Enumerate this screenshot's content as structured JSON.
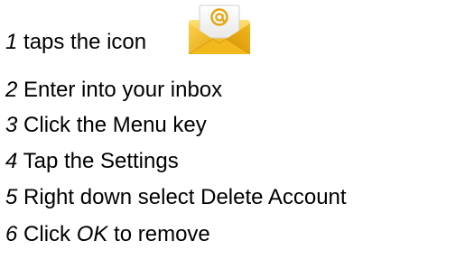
{
  "steps": [
    {
      "num": "1",
      "text": " taps the icon"
    },
    {
      "num": "2",
      "text": " Enter into your inbox"
    },
    {
      "num": "3",
      "text": " Click the Menu key"
    },
    {
      "num": "4",
      "text": " Tap the Settings"
    },
    {
      "num": "5",
      "text": " Right down select Delete Account"
    },
    {
      "num": "6",
      "pre": " Click ",
      "em": "OK",
      "post": " to remove"
    }
  ],
  "icon": {
    "name": "email-app-icon",
    "glyph": "@",
    "accent": "#f2b81c"
  }
}
